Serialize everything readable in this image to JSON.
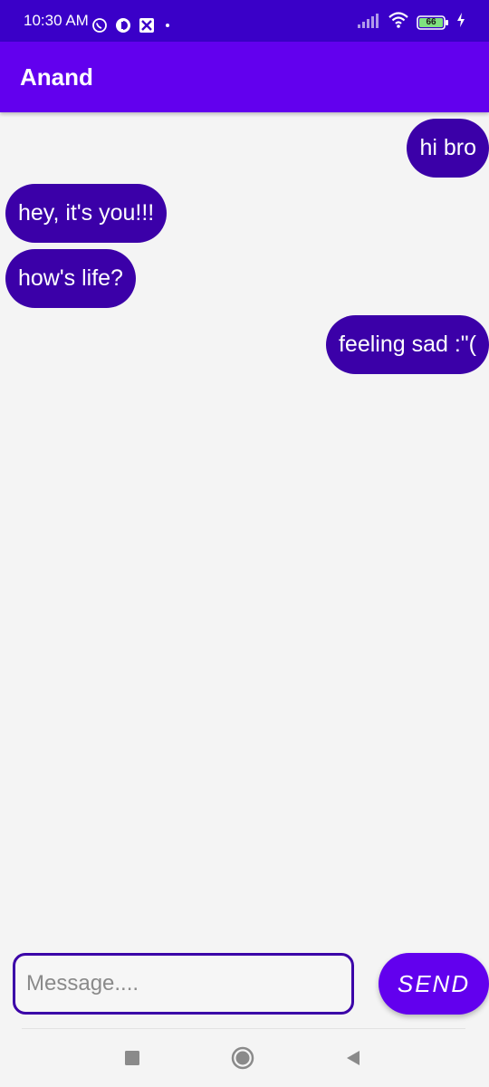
{
  "status_bar": {
    "time": "10:30 AM",
    "battery": "66",
    "icons": [
      "whatsapp-icon",
      "data-saver-icon",
      "screen-recorder-icon",
      "dot-icon",
      "signal-icon",
      "wifi-icon",
      "battery-icon",
      "charging-icon"
    ]
  },
  "app_bar": {
    "title": "Anand"
  },
  "messages": [
    {
      "text": "hi bro",
      "direction": "sent"
    },
    {
      "text": "hey, it's you!!!",
      "direction": "received"
    },
    {
      "text": "how's life?",
      "direction": "received"
    },
    {
      "text": "feeling sad :\"(",
      "direction": "sent"
    }
  ],
  "composer": {
    "placeholder": "Message....",
    "value": "",
    "send_label": "SEND"
  },
  "nav_bar": {
    "icons": [
      "recents-icon",
      "home-icon",
      "back-icon"
    ]
  },
  "colors": {
    "status_bar": "#3a00c8",
    "app_bar": "#6200ee",
    "bubble": "#3b00a8",
    "background": "#f4f4f4"
  }
}
